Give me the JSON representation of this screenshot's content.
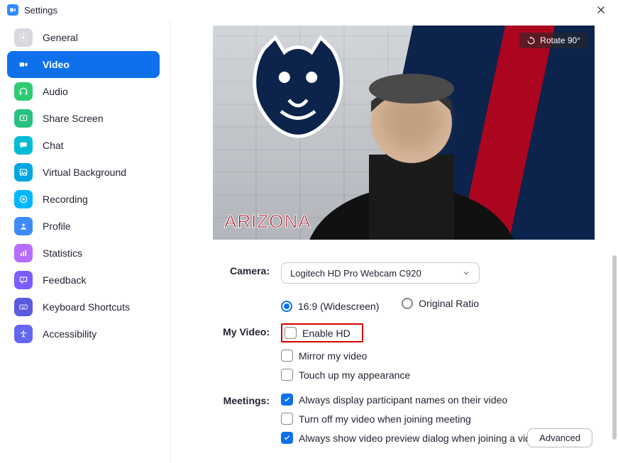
{
  "window": {
    "title": "Settings"
  },
  "sidebar": {
    "items": [
      {
        "label": "General"
      },
      {
        "label": "Video"
      },
      {
        "label": "Audio"
      },
      {
        "label": "Share Screen"
      },
      {
        "label": "Chat"
      },
      {
        "label": "Virtual Background"
      },
      {
        "label": "Recording"
      },
      {
        "label": "Profile"
      },
      {
        "label": "Statistics"
      },
      {
        "label": "Feedback"
      },
      {
        "label": "Keyboard Shortcuts"
      },
      {
        "label": "Accessibility"
      }
    ],
    "active_index": 1
  },
  "preview": {
    "rotate_label": "Rotate 90°",
    "arizona_text": "ARIZONA"
  },
  "camera": {
    "section_label": "Camera:",
    "selected": "Logitech HD Pro Webcam C920",
    "aspect": {
      "widescreen": "16:9 (Widescreen)",
      "original": "Original Ratio",
      "value": "widescreen"
    }
  },
  "my_video": {
    "section_label": "My Video:",
    "enable_hd": {
      "label": "Enable HD",
      "checked": false
    },
    "mirror": {
      "label": "Mirror my video",
      "checked": false
    },
    "touchup": {
      "label": "Touch up my appearance",
      "checked": false
    }
  },
  "meetings": {
    "section_label": "Meetings:",
    "show_names": {
      "label": "Always display participant names on their video",
      "checked": true
    },
    "turn_off": {
      "label": "Turn off my video when joining meeting",
      "checked": false
    },
    "preview_dialog": {
      "label": "Always show video preview dialog when joining a video meeting",
      "checked": true
    }
  },
  "advanced_label": "Advanced"
}
